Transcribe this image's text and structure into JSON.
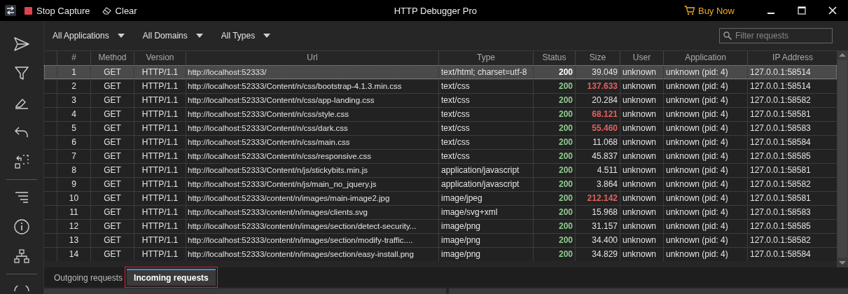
{
  "titlebar": {
    "title": "HTTP Debugger Pro",
    "actions": [
      {
        "kind": "stop",
        "label": "Stop Capture"
      },
      {
        "kind": "clear",
        "label": "Clear"
      }
    ],
    "buy": "Buy Now"
  },
  "sidebar": {
    "items": [
      {
        "kind": "send"
      },
      {
        "kind": "filter"
      },
      {
        "kind": "brush"
      },
      {
        "kind": "undo"
      },
      {
        "kind": "select"
      },
      {
        "kind": "divider"
      },
      {
        "kind": "lines"
      },
      {
        "kind": "info"
      },
      {
        "kind": "sitemap"
      },
      {
        "kind": "divider"
      },
      {
        "kind": "circle"
      }
    ]
  },
  "filters": [
    "All Applications",
    "All Domains",
    "All Types"
  ],
  "search": {
    "placeholder": "Filter requests"
  },
  "table": {
    "columns": [
      "#",
      "Method",
      "Version",
      "Url",
      "Type",
      "Status",
      "Size",
      "User",
      "Application",
      "IP Address"
    ],
    "rows": [
      {
        "selected": true,
        "large": false,
        "cells": [
          "1",
          "GET",
          "HTTP/1.1",
          "http://localhost:52333/",
          "text/html; charset=utf-8",
          "200",
          "39.049",
          "unknown",
          "unknown (pid: 4)",
          "127.0.0.1:58514"
        ]
      },
      {
        "selected": false,
        "large": true,
        "cells": [
          "2",
          "GET",
          "HTTP/1.1",
          "http://localhost:52333/Content/n/css/bootstrap-4.1.3.min.css",
          "text/css",
          "200",
          "137.633",
          "unknown",
          "unknown (pid: 4)",
          "127.0.0.1:58514"
        ]
      },
      {
        "selected": false,
        "large": false,
        "cells": [
          "3",
          "GET",
          "HTTP/1.1",
          "http://localhost:52333/Content/n/css/app-landing.css",
          "text/css",
          "200",
          "20.284",
          "unknown",
          "unknown (pid: 4)",
          "127.0.0.1:58582"
        ]
      },
      {
        "selected": false,
        "large": true,
        "cells": [
          "4",
          "GET",
          "HTTP/1.1",
          "http://localhost:52333/Content/n/css/style.css",
          "text/css",
          "200",
          "68.121",
          "unknown",
          "unknown (pid: 4)",
          "127.0.0.1:58581"
        ]
      },
      {
        "selected": false,
        "large": true,
        "cells": [
          "5",
          "GET",
          "HTTP/1.1",
          "http://localhost:52333/Content/n/css/dark.css",
          "text/css",
          "200",
          "55.460",
          "unknown",
          "unknown (pid: 4)",
          "127.0.0.1:58583"
        ]
      },
      {
        "selected": false,
        "large": false,
        "cells": [
          "6",
          "GET",
          "HTTP/1.1",
          "http://localhost:52333/Content/n/css/main.css",
          "text/css",
          "200",
          "11.068",
          "unknown",
          "unknown (pid: 4)",
          "127.0.0.1:58584"
        ]
      },
      {
        "selected": false,
        "large": false,
        "cells": [
          "7",
          "GET",
          "HTTP/1.1",
          "http://localhost:52333/Content/n/css/responsive.css",
          "text/css",
          "200",
          "45.837",
          "unknown",
          "unknown (pid: 4)",
          "127.0.0.1:58585"
        ]
      },
      {
        "selected": false,
        "large": false,
        "cells": [
          "8",
          "GET",
          "HTTP/1.1",
          "http://localhost:52333/Content/n/js/stickybits.min.js",
          "application/javascript",
          "200",
          "4.511",
          "unknown",
          "unknown (pid: 4)",
          "127.0.0.1:58581"
        ]
      },
      {
        "selected": false,
        "large": false,
        "cells": [
          "9",
          "GET",
          "HTTP/1.1",
          "http://localhost:52333/Content/n/js/main_no_jquery.js",
          "application/javascript",
          "200",
          "3.864",
          "unknown",
          "unknown (pid: 4)",
          "127.0.0.1:58582"
        ]
      },
      {
        "selected": false,
        "large": true,
        "cells": [
          "10",
          "GET",
          "HTTP/1.1",
          "http://localhost:52333/content/n/images/main-image2.jpg",
          "image/jpeg",
          "200",
          "212.142",
          "unknown",
          "unknown (pid: 4)",
          "127.0.0.1:58581"
        ]
      },
      {
        "selected": false,
        "large": false,
        "cells": [
          "11",
          "GET",
          "HTTP/1.1",
          "http://localhost:52333/content/n/images/clients.svg",
          "image/svg+xml",
          "200",
          "15.968",
          "unknown",
          "unknown (pid: 4)",
          "127.0.0.1:58583"
        ]
      },
      {
        "selected": false,
        "large": false,
        "cells": [
          "12",
          "GET",
          "HTTP/1.1",
          "http://localhost:52333/content/n/images/section/detect-security...",
          "image/png",
          "200",
          "31.157",
          "unknown",
          "unknown (pid: 4)",
          "127.0.0.1:58585"
        ]
      },
      {
        "selected": false,
        "large": false,
        "cells": [
          "13",
          "GET",
          "HTTP/1.1",
          "http://localhost:52333/content/n/images/section/modify-traffic....",
          "image/png",
          "200",
          "34.400",
          "unknown",
          "unknown (pid: 4)",
          "127.0.0.1:58582"
        ]
      },
      {
        "selected": false,
        "large": false,
        "cells": [
          "14",
          "GET",
          "HTTP/1.1",
          "http://localhost:52333/content/n/images/section/easy-install.png",
          "image/png",
          "200",
          "34.829",
          "unknown",
          "unknown (pid: 4)",
          "127.0.0.1:58584"
        ]
      }
    ]
  },
  "tabs": [
    {
      "label": "Outgoing requests",
      "selected": false,
      "highlighted": false
    },
    {
      "label": "Incoming requests",
      "selected": true,
      "highlighted": true
    }
  ]
}
